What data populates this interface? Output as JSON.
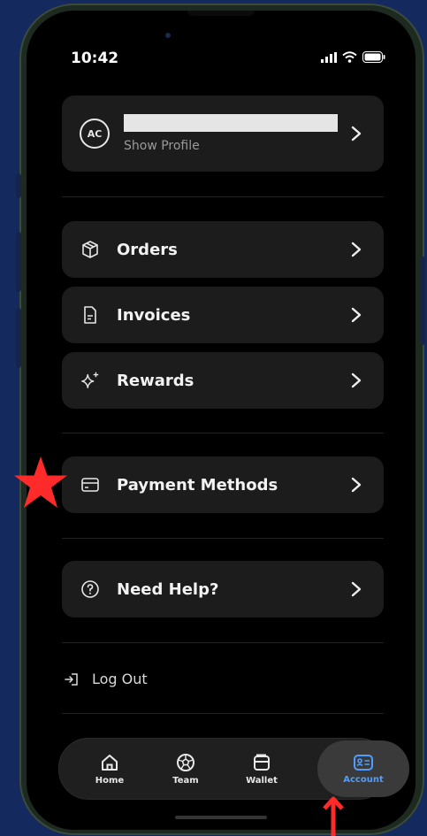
{
  "status": {
    "time": "10:42"
  },
  "profile": {
    "initials": "AC",
    "subtitle": "Show Profile"
  },
  "menu": {
    "orders": "Orders",
    "invoices": "Invoices",
    "rewards": "Rewards",
    "payment_methods": "Payment Methods",
    "need_help": "Need Help?"
  },
  "logout": "Log Out",
  "tabs": {
    "home": "Home",
    "team": "Team",
    "wallet": "Wallet",
    "account": "Account"
  },
  "colors": {
    "active_tab": "#4f9dff",
    "annotation": "#ff2a2a",
    "background": "#142a5e"
  },
  "icons": [
    "box-icon",
    "document-icon",
    "sparkles-icon",
    "card-icon",
    "help-circle-icon",
    "logout-icon",
    "chevron-right-icon",
    "home-icon",
    "soccer-ball-icon",
    "wallet-icon",
    "account-card-icon"
  ]
}
